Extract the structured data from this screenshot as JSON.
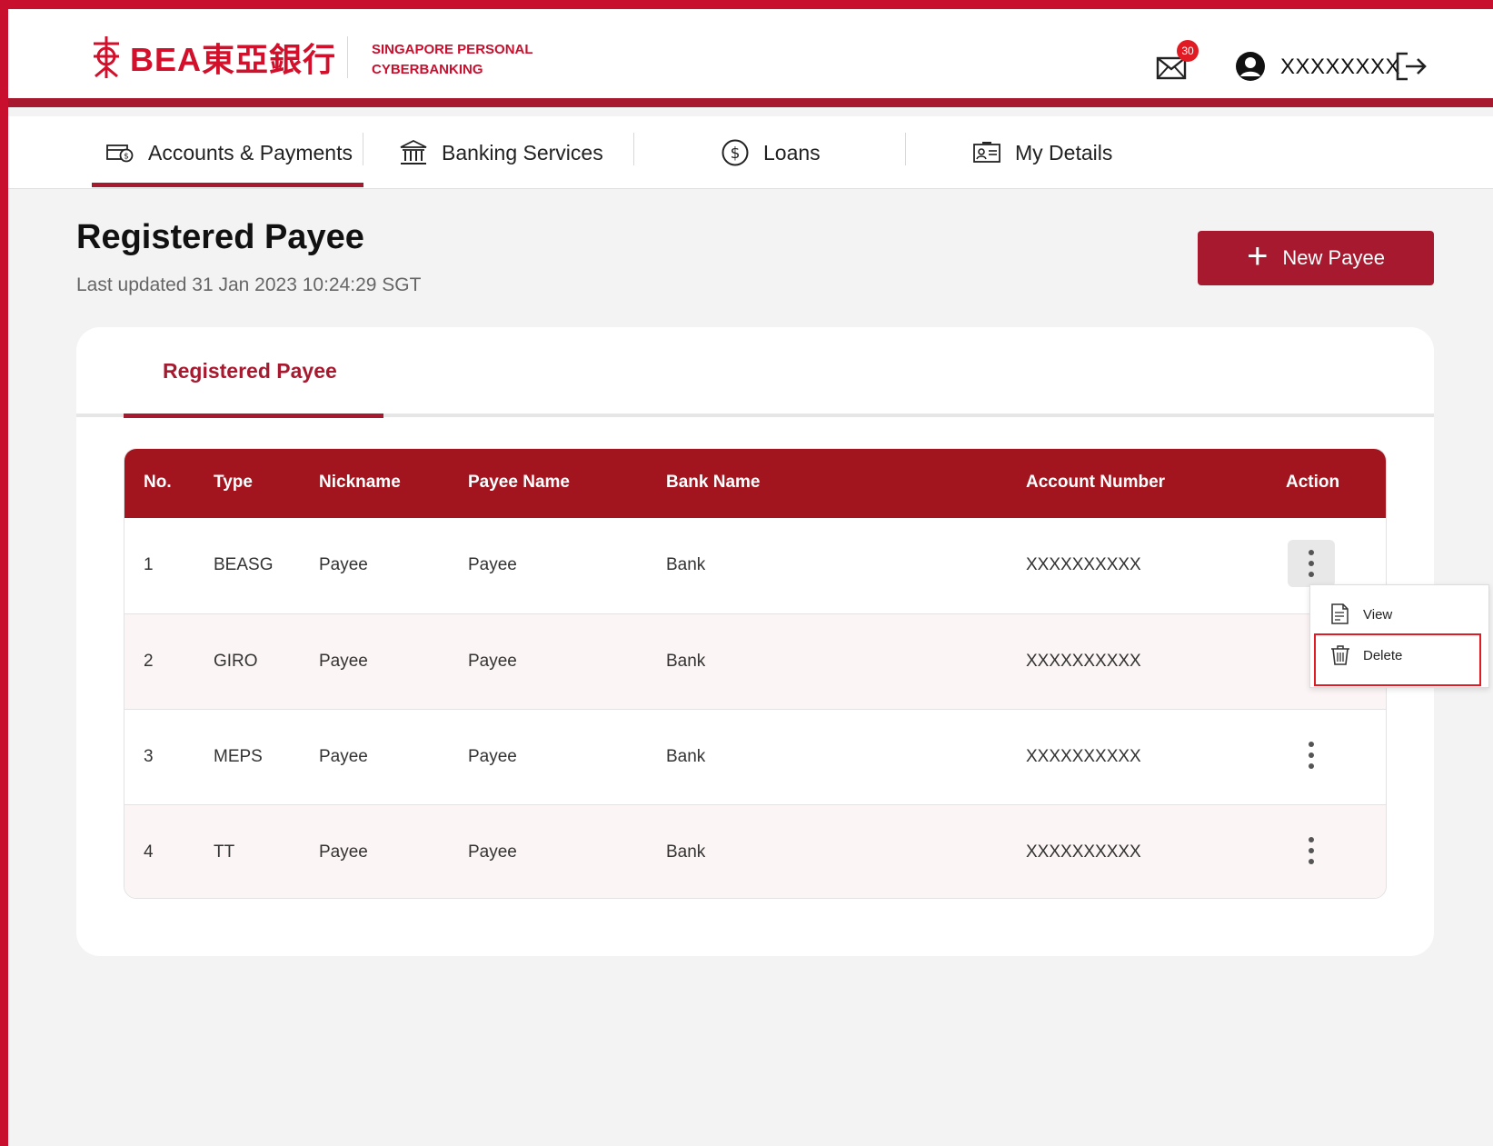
{
  "brand": {
    "logo_text": "BEA東亞銀行",
    "tagline": "SINGAPORE PERSONAL CYBERBANKING"
  },
  "header": {
    "mail_badge_count": "30",
    "username": "XXXXXXXX"
  },
  "nav": {
    "items": [
      {
        "label": "Accounts & Payments",
        "icon": "card-money-icon",
        "active": true
      },
      {
        "label": "Banking Services",
        "icon": "bank-icon",
        "active": false
      },
      {
        "label": "Loans",
        "icon": "dollar-circle-icon",
        "active": false
      },
      {
        "label": "My Details",
        "icon": "id-card-icon",
        "active": false
      }
    ]
  },
  "page": {
    "title": "Registered Payee",
    "last_updated": "Last updated 31 Jan 2023 10:24:29 SGT",
    "new_payee_label": "New Payee"
  },
  "card": {
    "tab_label": "Registered Payee"
  },
  "table": {
    "headers": [
      "No.",
      "Type",
      "Nickname",
      "Payee Name",
      "Bank Name",
      "Account Number",
      "Action"
    ],
    "rows": [
      {
        "no": "1",
        "type": "BEASG",
        "nickname": "Payee",
        "payee_name": "Payee",
        "bank_name": "Bank",
        "account_number": "XXXXXXXXXX"
      },
      {
        "no": "2",
        "type": "GIRO",
        "nickname": "Payee",
        "payee_name": "Payee",
        "bank_name": "Bank",
        "account_number": "XXXXXXXXXX"
      },
      {
        "no": "3",
        "type": "MEPS",
        "nickname": "Payee",
        "payee_name": "Payee",
        "bank_name": "Bank",
        "account_number": "XXXXXXXXXX"
      },
      {
        "no": "4",
        "type": "TT",
        "nickname": "Payee",
        "payee_name": "Payee",
        "bank_name": "Bank",
        "account_number": "XXXXXXXXXX"
      }
    ]
  },
  "action_menu": {
    "view_label": "View",
    "delete_label": "Delete"
  },
  "colors": {
    "brand_red": "#c8102e",
    "header_dark_red": "#a2151f",
    "highlight_red": "#e01b24"
  }
}
